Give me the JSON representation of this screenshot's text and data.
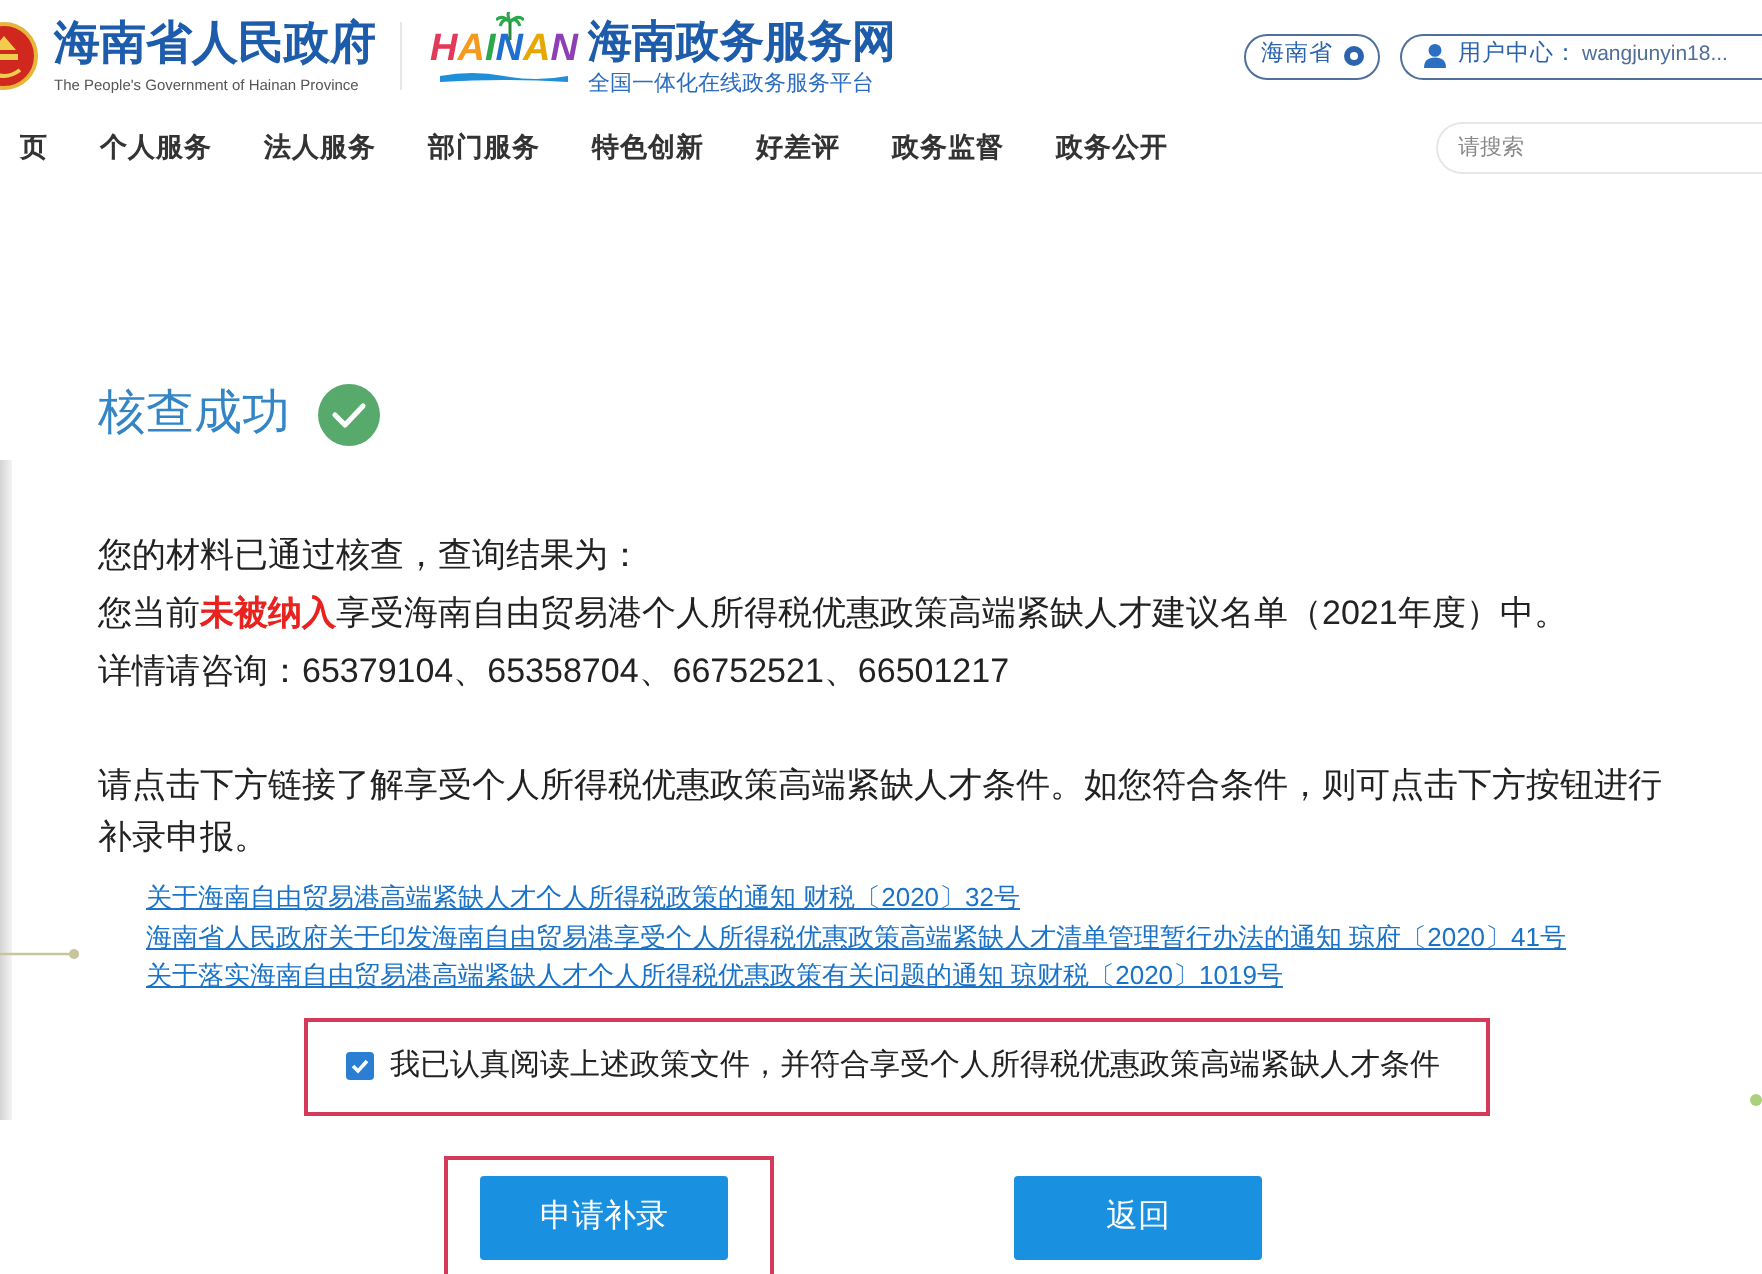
{
  "header": {
    "gov_title": "海南省人民政府",
    "gov_subtitle": "The People's Government of Hainan Province",
    "logo_text": "HAINAN",
    "site_title": "海南政务服务网",
    "site_subtitle": "全国一体化在线政务服务平台",
    "region": "海南省",
    "user_label": "用户中心：",
    "user_name": "wangjunyin18..."
  },
  "nav": {
    "items": [
      "页",
      "个人服务",
      "法人服务",
      "部门服务",
      "特色创新",
      "好差评",
      "政务监督",
      "政务公开"
    ],
    "search": {
      "placeholder": "请搜索"
    }
  },
  "result": {
    "title": "核查成功",
    "lines": [
      "您的材料已通过核查，查询结果为：",
      "您当前**未被纳入**享受海南自由贸易港个人所得税优惠政策高端紧缺人才建议名单（2021年度）中。",
      "详情请咨询：65379104、65358704、66752521、66501217"
    ],
    "instruction": "请点击下方链接了解享受个人所得税优惠政策高端紧缺人才条件。如您符合条件，则可点击下方按钮进行补录申报。",
    "links": [
      "关于海南自由贸易港高端紧缺人才个人所得税政策的通知 财税〔2020〕32号",
      "海南省人民政府关于印发海南自由贸易港享受个人所得税优惠政策高端紧缺人才清单管理暂行办法的通知 琼府〔2020〕41号",
      "关于落实海南自由贸易港高端紧缺人才个人所得税优惠政策有关问题的通知 琼财税〔2020〕1019号"
    ],
    "agreement": {
      "label": "我已认真阅读上述政策文件，并符合享受个人所得税优惠政策高端紧缺人才条件",
      "checked": true,
      "highlighted": true
    },
    "buttons": [
      {
        "label": "申请补录",
        "highlighted": true
      },
      {
        "label": "返回",
        "highlighted": false
      }
    ]
  }
}
